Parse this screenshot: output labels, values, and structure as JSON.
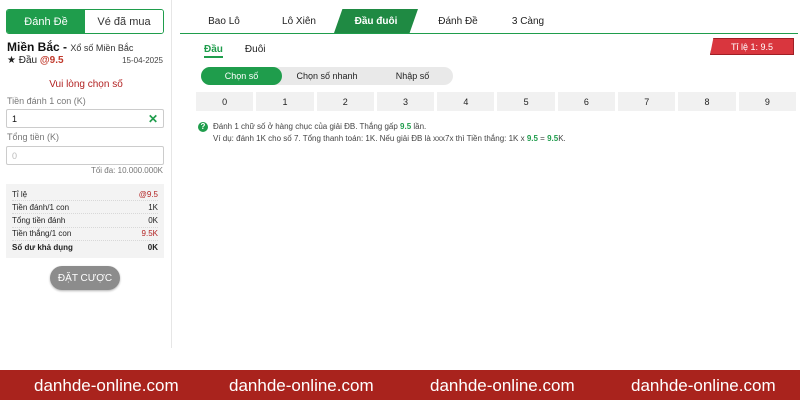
{
  "left": {
    "tabs": [
      "Đánh Đề",
      "Vé đã mua"
    ],
    "region_title": "Miền Bắc -",
    "region_sub": "Xổ số Miền Bắc",
    "bet_star": "★",
    "bet_type": "Đầu",
    "bet_odds": "@9.5",
    "date": "15-04-2025",
    "prompt": "Vui lòng chọn số",
    "per_label": "Tiền đánh 1 con (K)",
    "per_value": "1",
    "total_label": "Tổng tiền (K)",
    "total_placeholder": "0",
    "max_note": "Tối đa: 10.000.000K",
    "summary": [
      {
        "label": "Tỉ lệ",
        "value": "@9.5",
        "red": true
      },
      {
        "label": "Tiền đánh/1 con",
        "value": "1K",
        "red": false
      },
      {
        "label": "Tổng tiền đánh",
        "value": "0K",
        "red": false
      },
      {
        "label": "Tiền thắng/1 con",
        "value": "9.5K",
        "red": true
      },
      {
        "label": "Số dư khả dụng",
        "value": "0K",
        "red": false
      }
    ],
    "submit": "ĐẶT CƯỢC"
  },
  "right": {
    "tabs": [
      "Bao Lô",
      "Lô Xiên",
      "Đầu đuôi",
      "Đánh Đề",
      "3 Càng"
    ],
    "active_tab": "Đầu đuôi",
    "sub_tabs": [
      "Đầu",
      "Đuôi"
    ],
    "rate": "Tỉ lệ 1: 9.5",
    "mode_tabs": [
      "Chọn số",
      "Chọn số nhanh",
      "Nhập số"
    ],
    "numbers": [
      "0",
      "1",
      "2",
      "3",
      "4",
      "5",
      "6",
      "7",
      "8",
      "9"
    ],
    "help_line1_a": "Đánh 1 chữ số ở hàng chục của giải ĐB. Thắng gấp ",
    "help_line1_b": "9.5",
    "help_line1_c": " lần.",
    "help_line2_a": "Ví dụ: đánh 1K cho số 7. Tổng thanh toán: 1K. Nếu giải ĐB là xxx7x thì Tiền thắng: 1K x ",
    "help_line2_b": "9.5",
    "help_line2_c": " = ",
    "help_line2_d": "9.5",
    "help_line2_e": "K."
  },
  "footer": {
    "watermarks": [
      "danhde-online.com",
      "danhde-online.com",
      "danhde-online.com",
      "danhde-online.com"
    ]
  },
  "colors": {
    "accent": "#1f9d4c",
    "red": "#d9363e",
    "footer": "#a9231d"
  }
}
